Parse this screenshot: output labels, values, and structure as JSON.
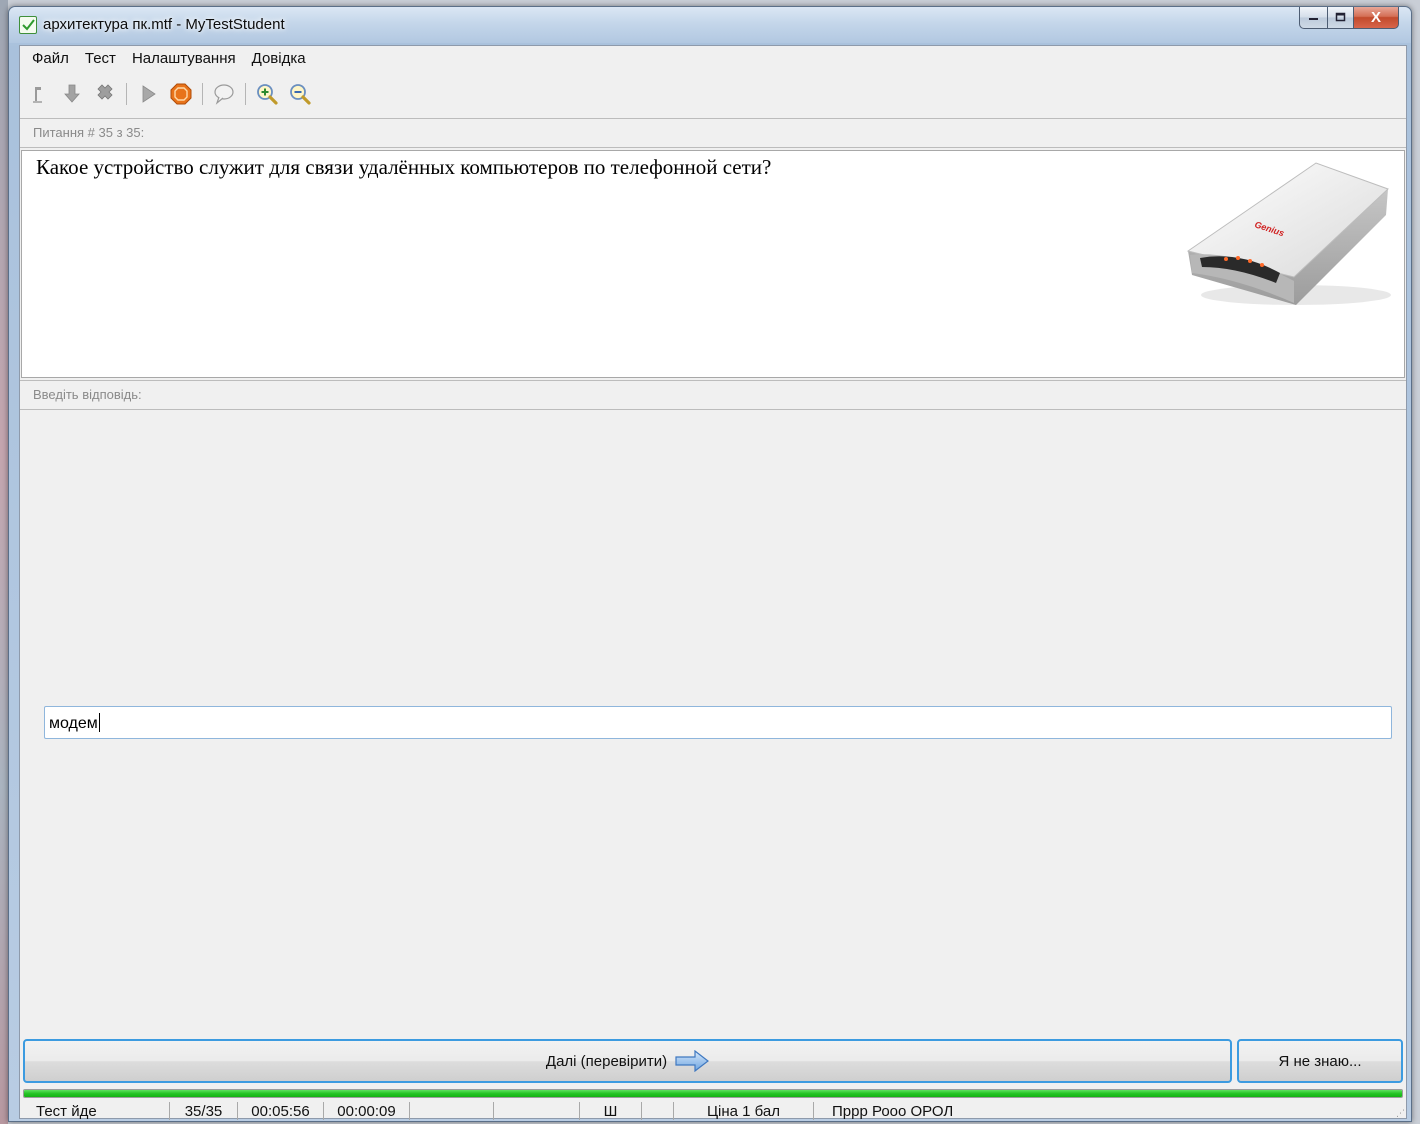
{
  "window": {
    "title": "архитектура пк.mtf - MyTestStudent",
    "controls": {
      "minimize": "–",
      "maximize": "□",
      "close": "X"
    }
  },
  "menu": [
    "Файл",
    "Тест",
    "Налаштування",
    "Довідка"
  ],
  "toolbar": {
    "icons": [
      "open-file-icon",
      "save-icon",
      "delete-icon",
      "play-icon",
      "stop-icon",
      "comment-icon",
      "zoom-in-icon",
      "zoom-out-icon"
    ],
    "accent_stop": "#e8731a"
  },
  "question": {
    "header": "Питання # 35 з 35:",
    "text": "Какое устройство служит для связи удалённых компьютеров по телефонной сети?",
    "image_brand": "Genius"
  },
  "answer": {
    "header": "Введіть відповідь:",
    "value": "модем"
  },
  "buttons": {
    "next": "Далі (перевірити)",
    "dont_know": "Я не знаю..."
  },
  "progress": {
    "fraction": 1.0,
    "color": "#25c425"
  },
  "statusbar": {
    "state": "Тест йде",
    "count": "35/35",
    "elapsed": "00:05:56",
    "question_time": "00:00:09",
    "empty1": "",
    "empty2": "",
    "layout": "Ш",
    "empty3": "",
    "price": "Ціна 1 бал",
    "student": "Пррр Рооо ОРОЛ"
  },
  "colors": {
    "button_border": "#3c9be0",
    "titlebar": "#c4d6ea"
  }
}
